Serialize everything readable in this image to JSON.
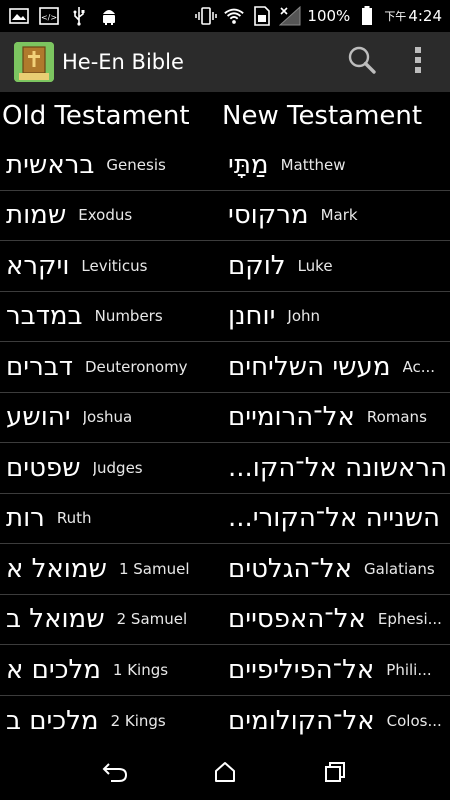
{
  "status_bar": {
    "battery_percent": "100%",
    "time_prefix": "下午",
    "time": "4:24",
    "icons": [
      "image-icon",
      "code-icon",
      "usb-icon",
      "android-icon",
      "vibrate-icon",
      "wifi-icon",
      "sim-icon",
      "signal-icon",
      "battery-icon"
    ]
  },
  "action_bar": {
    "app_title": "He-En Bible",
    "app_icon_caption": "ספר",
    "search_icon": "search-icon",
    "overflow_icon": "more-vert-icon"
  },
  "headers": {
    "old_testament": "Old Testament",
    "new_testament": "New Testament"
  },
  "books": {
    "old_testament": [
      {
        "hebrew": "בראשית",
        "english": "Genesis"
      },
      {
        "hebrew": "שמות",
        "english": "Exodus"
      },
      {
        "hebrew": "ויקרא",
        "english": "Leviticus"
      },
      {
        "hebrew": "במדבר",
        "english": "Numbers"
      },
      {
        "hebrew": "דברים",
        "english": "Deuteronomy"
      },
      {
        "hebrew": "יהושע",
        "english": "Joshua"
      },
      {
        "hebrew": "שפטים",
        "english": "Judges"
      },
      {
        "hebrew": "רות",
        "english": "Ruth"
      },
      {
        "hebrew": "שמואל א",
        "english": "1 Samuel"
      },
      {
        "hebrew": "שמואל ב",
        "english": "2 Samuel"
      },
      {
        "hebrew": "מלכים א",
        "english": "1 Kings"
      },
      {
        "hebrew": "מלכים ב",
        "english": "2 Kings"
      }
    ],
    "new_testament": [
      {
        "hebrew": "מַתָּי",
        "english": "Matthew"
      },
      {
        "hebrew": "מרקוסי",
        "english": "Mark"
      },
      {
        "hebrew": "לוקם",
        "english": "Luke"
      },
      {
        "hebrew": "יוחנן",
        "english": "John"
      },
      {
        "hebrew": "מעשי השליחים",
        "english": "Ac..."
      },
      {
        "hebrew": "אל־הרומיים",
        "english": "Romans"
      },
      {
        "hebrew": "הראשונה אל־הקו...",
        "english": ""
      },
      {
        "hebrew": "השנייה אל־הקורי...",
        "english": ""
      },
      {
        "hebrew": "אל־הגלטים",
        "english": "Galatians"
      },
      {
        "hebrew": "אל־האפסיים",
        "english": "Ephesi..."
      },
      {
        "hebrew": "אל־הפיליפיים",
        "english": "Phili..."
      },
      {
        "hebrew": "אל־הקולומים",
        "english": "Colos..."
      }
    ]
  },
  "nav_bar": {
    "back_icon": "back-icon",
    "home_icon": "home-icon",
    "recents_icon": "recents-icon"
  }
}
